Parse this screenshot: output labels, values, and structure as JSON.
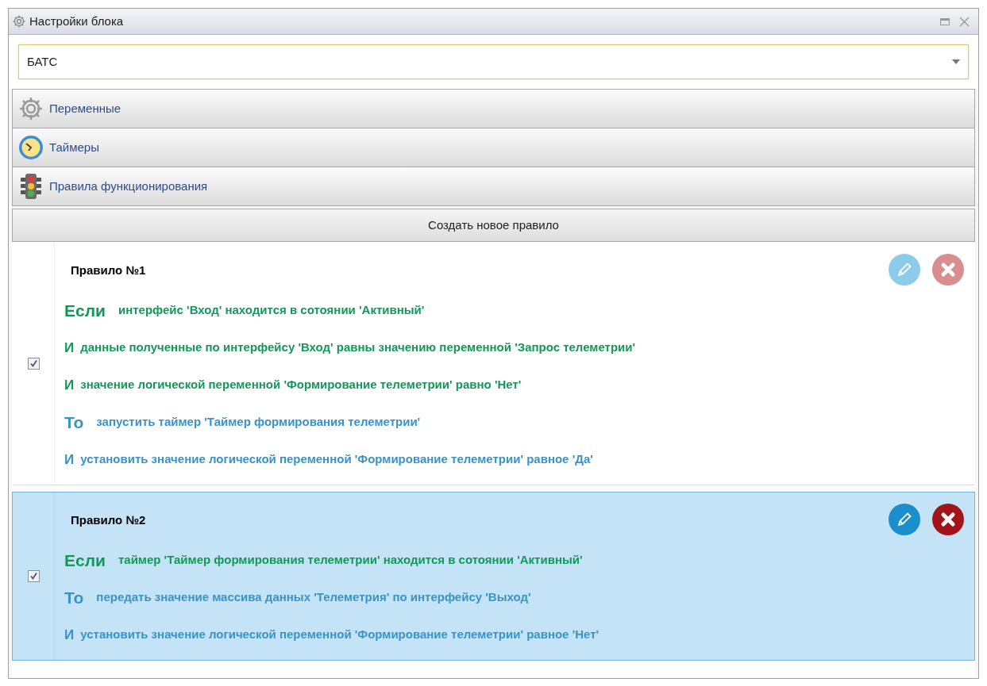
{
  "window": {
    "title": "Настройки блока"
  },
  "block_select": {
    "value": "БАТС"
  },
  "sections": [
    {
      "kind": "gear",
      "label": "Переменные"
    },
    {
      "kind": "clock",
      "label": "Таймеры"
    },
    {
      "kind": "traffic_light",
      "label": "Правила функционирования"
    }
  ],
  "create_button": "Создать новое правило",
  "rules": [
    {
      "title": "Правило №1",
      "checked": true,
      "selected": false,
      "conditions": [
        {
          "keyword": "Если",
          "text": "интерфейс 'Вход' находится в сотоянии 'Активный'"
        },
        {
          "keyword": "И",
          "text": "данные полученные по интерфейсу 'Вход' равны значению переменной 'Запрос телеметрии'"
        },
        {
          "keyword": "И",
          "text": "значение логической переменной 'Формирование телеметрии' равно 'Нет'"
        }
      ],
      "actions": [
        {
          "keyword": "То",
          "text": "запустить таймер 'Таймер формирования телеметрии'"
        },
        {
          "keyword": "И",
          "text": "установить значение логической переменной 'Формирование телеметрии' равное 'Да'"
        }
      ]
    },
    {
      "title": "Правило №2",
      "checked": true,
      "selected": true,
      "conditions": [
        {
          "keyword": "Если",
          "text": "таймер 'Таймер формирования телеметрии' находится в сотоянии 'Активный'"
        }
      ],
      "actions": [
        {
          "keyword": "То",
          "text": "передать значение массива данных 'Телеметрия' по интерфейсу 'Выход'"
        },
        {
          "keyword": "И",
          "text": "установить значение логической переменной 'Формирование телеметрии' равное 'Нет'"
        }
      ]
    }
  ]
}
